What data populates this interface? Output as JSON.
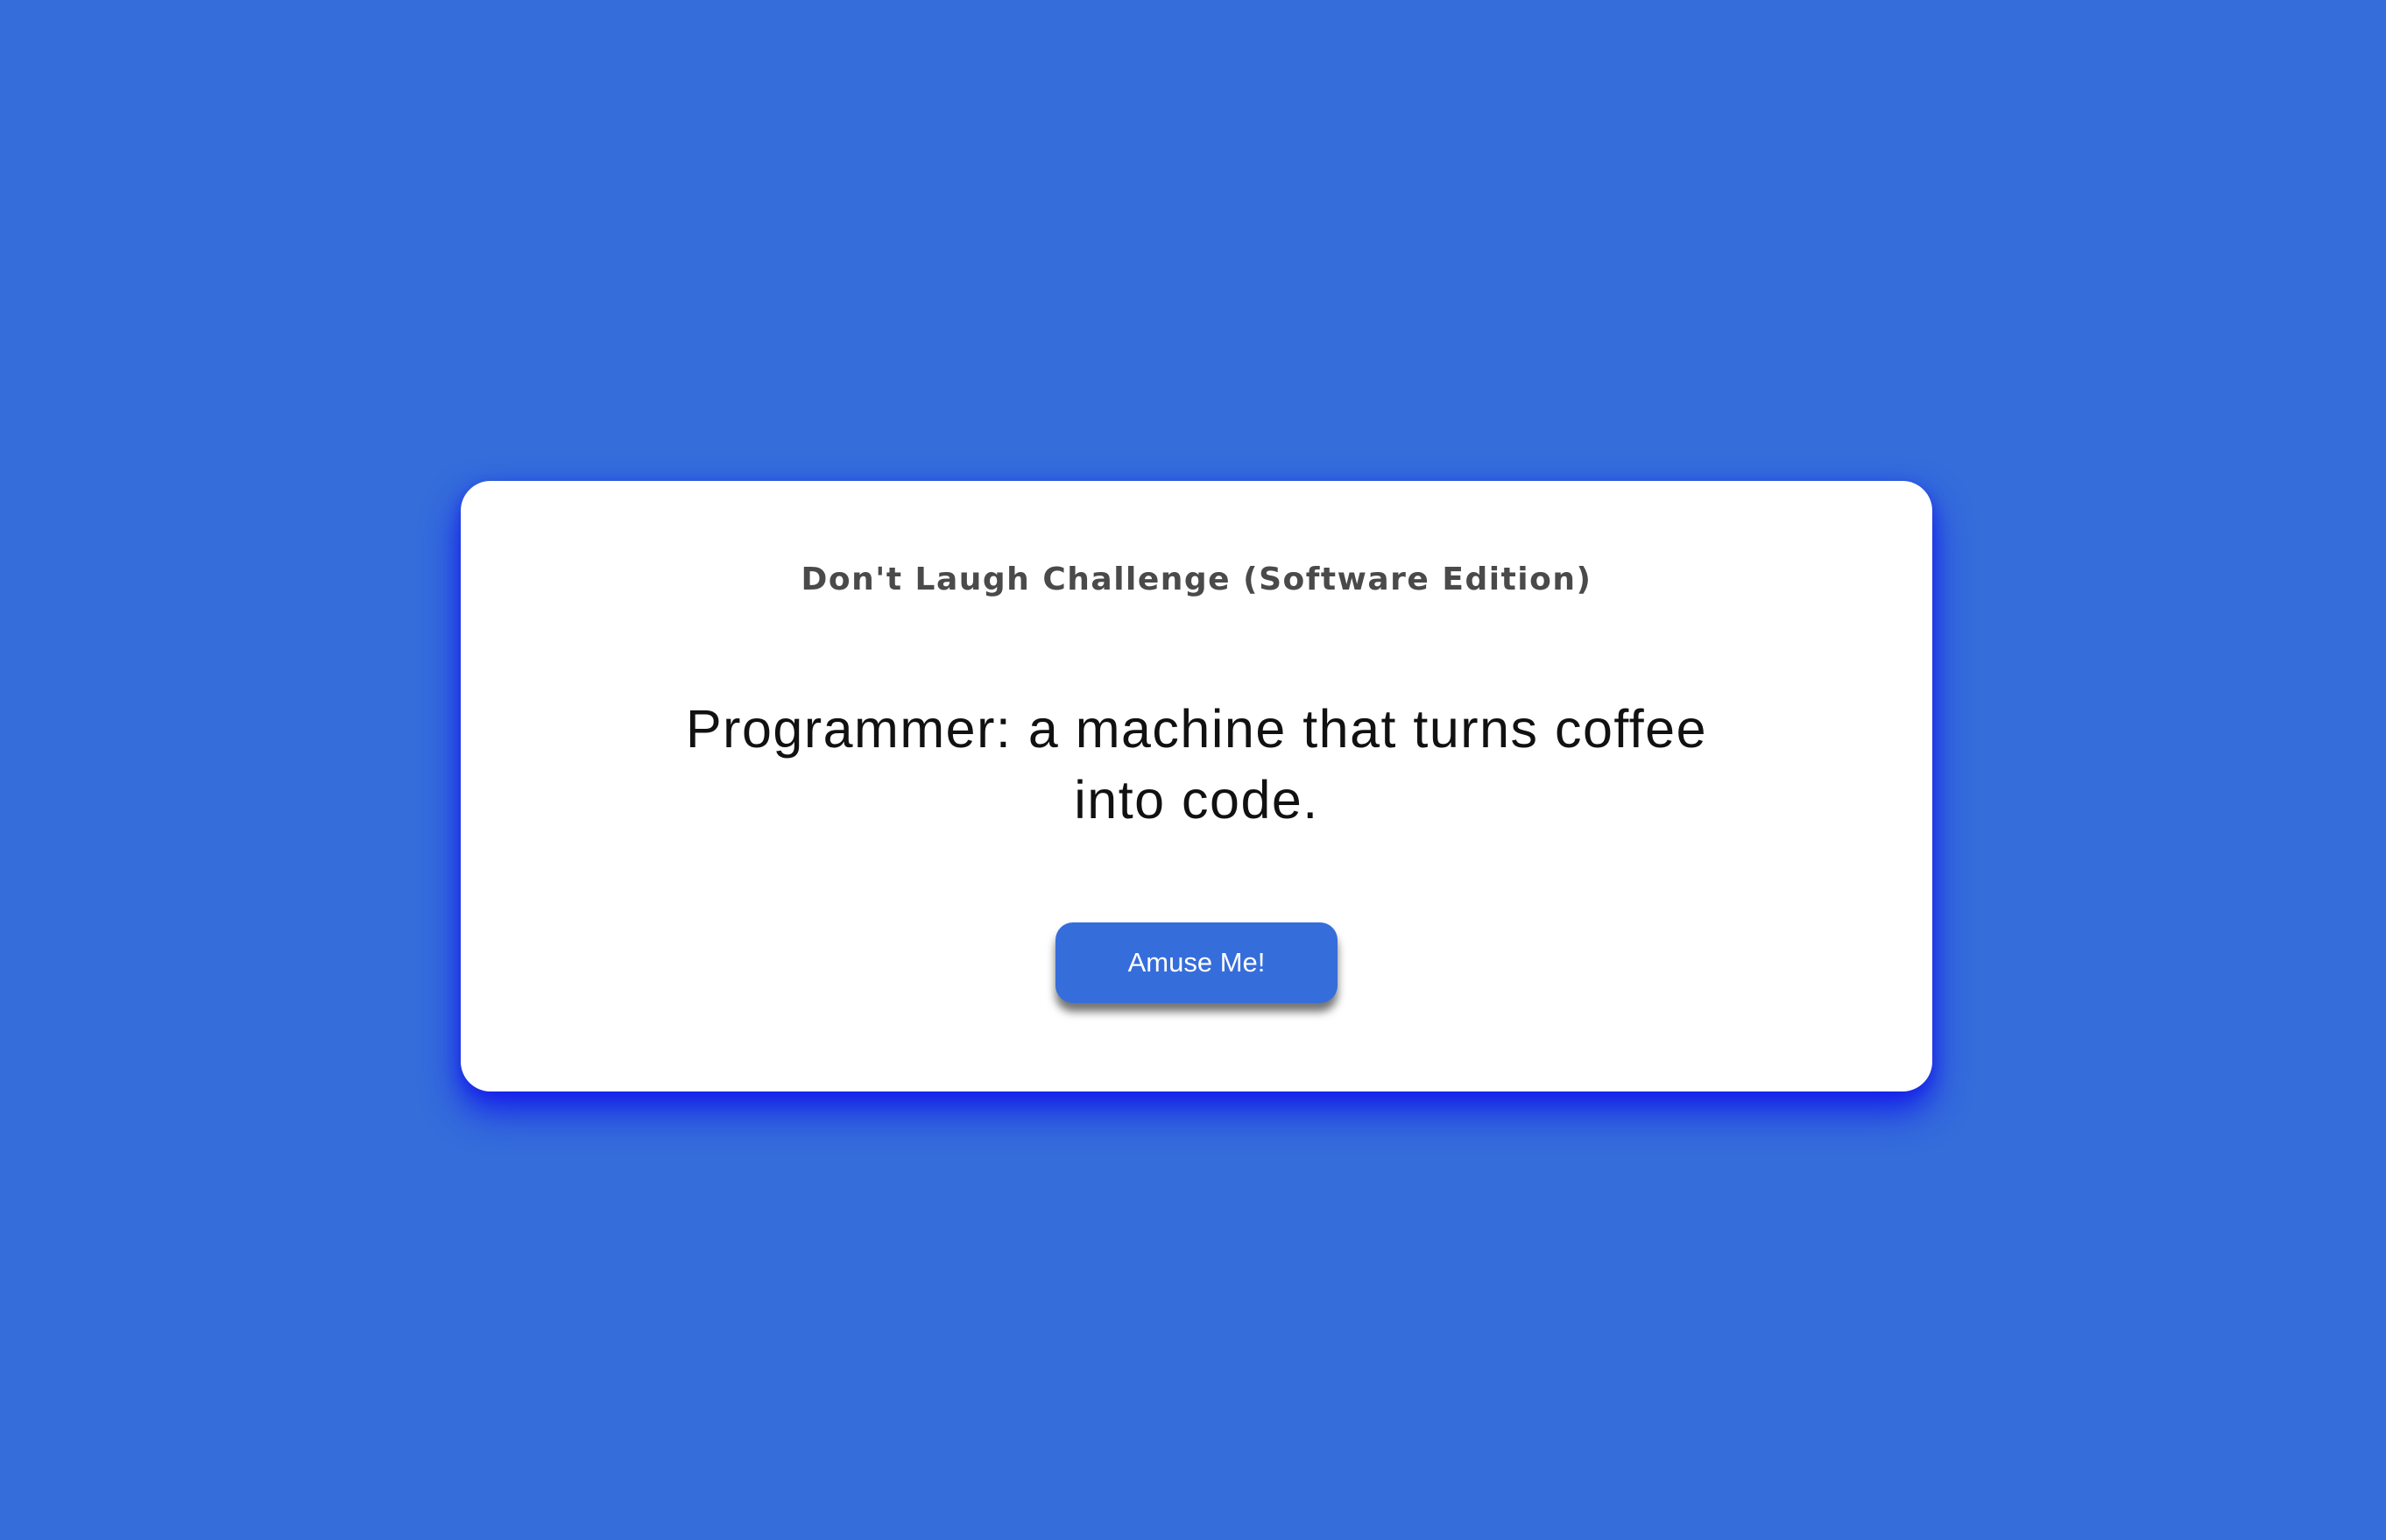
{
  "card": {
    "title": "Don't Laugh Challenge (Software Edition)",
    "joke": "Programmer: a machine that turns coffee into code.",
    "button_label": "Amuse Me!"
  }
}
